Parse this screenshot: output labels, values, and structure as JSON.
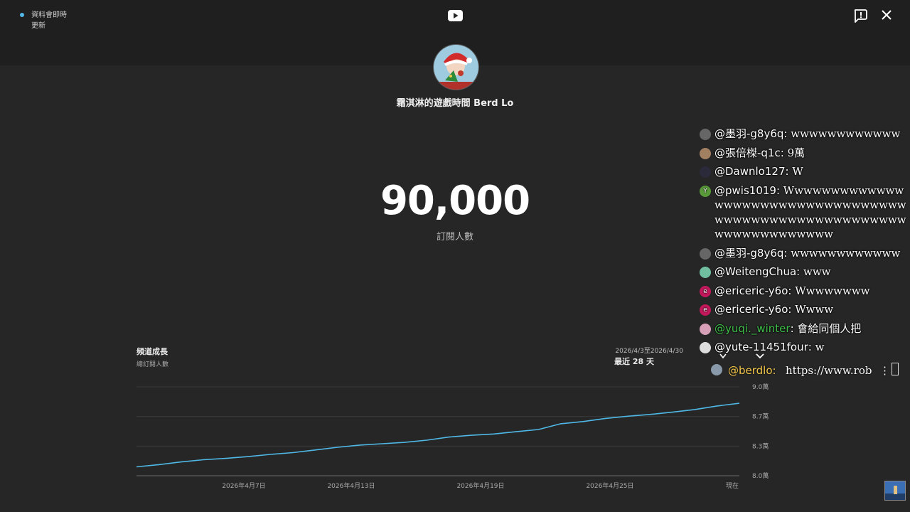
{
  "status": {
    "line1": "資料會即時",
    "line2": "更新",
    "dot_color": "#4fb8e6"
  },
  "channel": {
    "name": "霜淇淋的遊戲時間 Berd Lo"
  },
  "counter": {
    "value": "90,000",
    "label": "訂閱人數"
  },
  "panel": {
    "title": "頻道成長",
    "subtitle": "總訂閱人數",
    "range_dates": "2026/4/3至2026/4/30",
    "range_label": "最近 28 天"
  },
  "chart_data": {
    "type": "line",
    "x_tick_labels": [
      "2026年4月7日",
      "2026年4月13日",
      "2026年4月19日",
      "2026年4月25日",
      "現在"
    ],
    "y_tick_labels": [
      "9.0萬",
      "8.7萬",
      "8.3萬",
      "8.0萬"
    ],
    "ylim": [
      80000,
      90000
    ],
    "x": [
      "2026/4/3",
      "2026/4/4",
      "2026/4/5",
      "2026/4/6",
      "2026/4/7",
      "2026/4/8",
      "2026/4/9",
      "2026/4/10",
      "2026/4/11",
      "2026/4/12",
      "2026/4/13",
      "2026/4/14",
      "2026/4/15",
      "2026/4/16",
      "2026/4/17",
      "2026/4/18",
      "2026/4/19",
      "2026/4/20",
      "2026/4/21",
      "2026/4/22",
      "2026/4/23",
      "2026/4/24",
      "2026/4/25",
      "2026/4/26",
      "2026/4/27",
      "2026/4/28",
      "2026/4/29",
      "2026/4/30"
    ],
    "series": [
      {
        "values": [
          81000,
          81250,
          81550,
          81800,
          81950,
          82150,
          82400,
          82600,
          82900,
          83200,
          83450,
          83600,
          83750,
          84000,
          84350,
          84550,
          84700,
          84950,
          85200,
          85850,
          86100,
          86450,
          86700,
          86900,
          87150,
          87450,
          87850,
          88150
        ]
      }
    ],
    "line_color": "#4fb8e6",
    "grid": true
  },
  "chat": {
    "messages": [
      {
        "author": "@墨羽-g8y6q",
        "text": "wwwwwwwwwwww",
        "avatar_color": "#666666"
      },
      {
        "author": "@張倍榤-q1c",
        "text": "9萬",
        "avatar_color": "#a08060"
      },
      {
        "author": "@Dawnlo127",
        "text": "W",
        "avatar_color": "#2a2a3a"
      },
      {
        "author": "@pwis1019",
        "text": "Wwwwwwwwwwwwwwwwwwwwwwwwwwwwwwwwwwwwwwwwwwwwwwwwwwwwwwwwwwwwwwwwwwww",
        "avatar_color": "#5a9a3a",
        "avatar_letter": "Y"
      },
      {
        "author": "@墨羽-g8y6q",
        "text": "wwwwwwwwwwww",
        "avatar_color": "#666666"
      },
      {
        "author": "@WeitengChua",
        "text": "www",
        "avatar_color": "#6fbfa0"
      },
      {
        "author": "@ericeric-y6o",
        "text": "Wwwwwwww",
        "avatar_color": "#c2185b",
        "avatar_letter": "e"
      },
      {
        "author": "@ericeric-y6o",
        "text": "Wwww",
        "avatar_color": "#c2185b",
        "avatar_letter": "e"
      },
      {
        "author": "@yuqi._winter",
        "text": "會給同個人把",
        "avatar_color": "#d8a0b8",
        "green": true
      },
      {
        "author": "@yute-11451four",
        "text": "w",
        "avatar_color": "#dddddd"
      }
    ],
    "pinned": {
      "author": "@berdlo",
      "text": "https://www.rob...",
      "avatar_color": "#8899aa"
    }
  }
}
